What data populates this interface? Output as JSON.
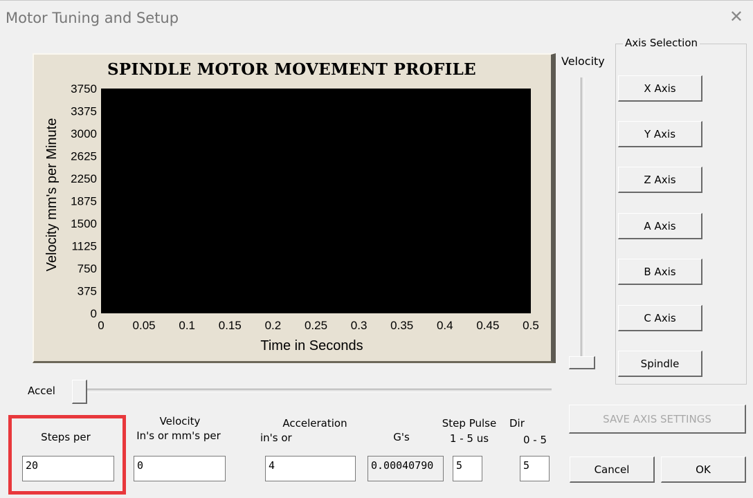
{
  "window": {
    "title": "Motor Tuning and Setup",
    "close_glyph": "✕"
  },
  "chart_data": {
    "type": "line",
    "title": "SPINDLE MOTOR MOVEMENT PROFILE",
    "xlabel": "Time in Seconds",
    "ylabel": "Velocity mm's per Minute",
    "xlim": [
      0,
      0.5
    ],
    "ylim": [
      0,
      3750
    ],
    "x_ticks": [
      "0",
      "0.05",
      "0.1",
      "0.15",
      "0.2",
      "0.25",
      "0.3",
      "0.35",
      "0.4",
      "0.45",
      "0.5"
    ],
    "y_ticks": [
      "0",
      "375",
      "750",
      "1125",
      "1500",
      "1875",
      "2250",
      "2625",
      "3000",
      "3375",
      "3750"
    ],
    "series": [],
    "plot_background": "#000000",
    "frame_background": "#e7e1d3"
  },
  "velocity_slider": {
    "label": "Velocity",
    "value": 0
  },
  "axis_selection": {
    "label": "Axis Selection",
    "buttons": [
      "X Axis",
      "Y Axis",
      "Z Axis",
      "A Axis",
      "B Axis",
      "C Axis",
      "Spindle"
    ]
  },
  "accel_slider": {
    "label": "Accel",
    "value": 0
  },
  "fields": {
    "steps": {
      "label": "Steps per",
      "value": "20"
    },
    "velocity": {
      "label_line1": "Velocity",
      "label_line2": "In's or mm's per",
      "value": "0"
    },
    "acceleration": {
      "label_line1": "Acceleration",
      "label_line2": "in's or",
      "value": "4"
    },
    "gs": {
      "label": "G's",
      "value": "0.00040790"
    },
    "step_pulse": {
      "label_line1": "Step Pulse",
      "label_line2": "1 - 5 us",
      "value": "5"
    },
    "dir": {
      "label_line1": "Dir",
      "label_line2": "0 - 5",
      "value": "5"
    }
  },
  "buttons": {
    "save": "SAVE AXIS SETTINGS",
    "cancel": "Cancel",
    "ok": "OK"
  },
  "highlight_color": "#e8383c"
}
